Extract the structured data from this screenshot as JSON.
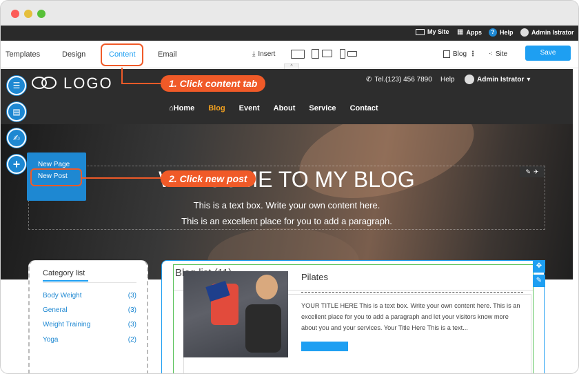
{
  "window": {
    "title": ""
  },
  "admin_bar": {
    "my_site": "My Site",
    "apps": "Apps",
    "help": "Help",
    "user": "Admin Istrator"
  },
  "toolbar": {
    "tabs": [
      "Templates",
      "Design",
      "Content",
      "Email"
    ],
    "active_tab": "Content",
    "insert": "Insert",
    "blog": "Blog",
    "site": "Site",
    "save": "Save"
  },
  "site_header": {
    "logo_text": "LOGO",
    "phone": "Tel.(123) 456 7890",
    "help": "Help",
    "user": "Admin Istrator"
  },
  "nav": {
    "items": [
      "Home",
      "Blog",
      "Event",
      "About",
      "Service",
      "Contact"
    ],
    "active": "Blog"
  },
  "hero": {
    "title": "WELCOME TO MY BLOG",
    "line1": "This is a text box. Write your own content here.",
    "line2": "This is an excellent place for you to add a paragraph."
  },
  "category": {
    "title": "Category list",
    "items": [
      {
        "name": "Body Weight",
        "count": "(3)"
      },
      {
        "name": "General",
        "count": "(3)"
      },
      {
        "name": "Weight Training",
        "count": "(3)"
      },
      {
        "name": "Yoga",
        "count": "(2)"
      }
    ]
  },
  "blog_list": {
    "title": "Blog list (11)",
    "post": {
      "title": "Pilates",
      "excerpt": "YOUR TITLE HERE This is a text box. Write your own content here. This is an excellent place for you to add a paragraph and let your visitors know more about you and your services. Your Title Here This is a text..."
    }
  },
  "fab_menu": {
    "new_page": "New Page",
    "new_post": "New Post"
  },
  "callouts": {
    "step1": "1. Click content tab",
    "step2": "2. Click new post"
  },
  "colors": {
    "accent": "#1e9ff2",
    "highlight": "#f05a28",
    "nav_active": "#f0a020"
  }
}
